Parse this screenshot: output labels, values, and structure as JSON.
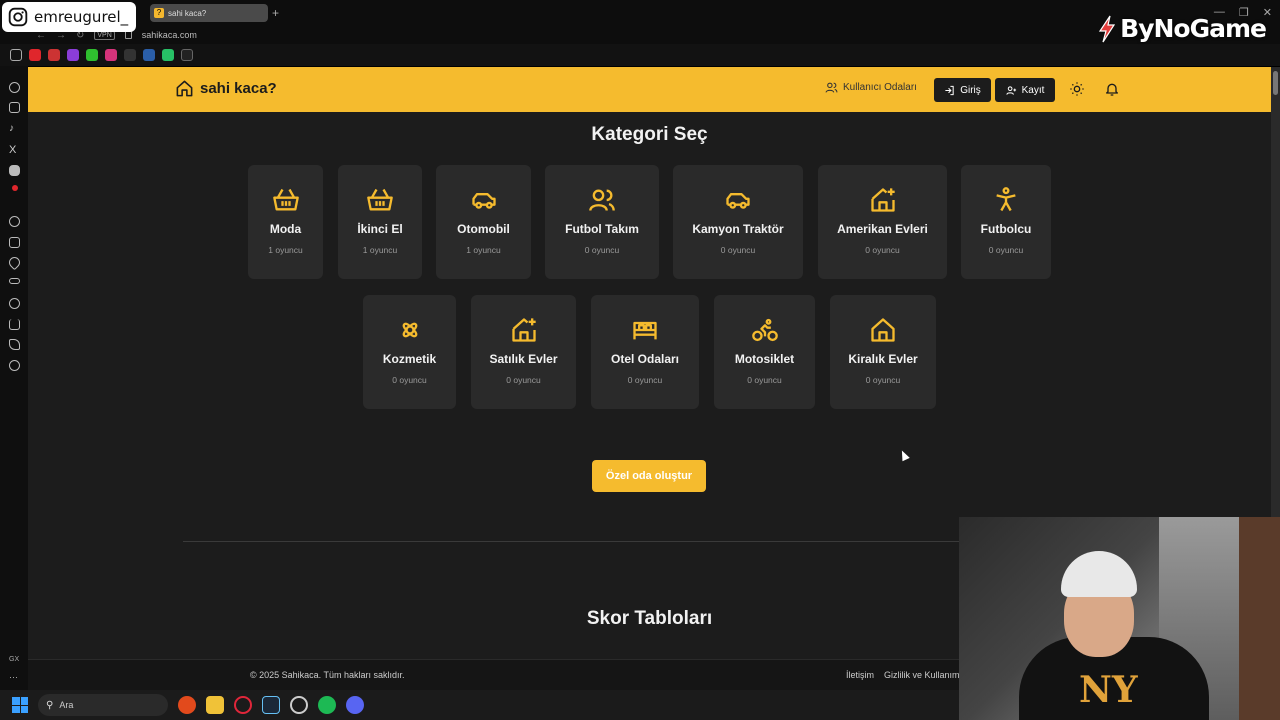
{
  "overlay": {
    "instagram_handle": "emreugurel_",
    "brand_logo": "ByNoGame"
  },
  "browser": {
    "tab_title": "sahi kaca?",
    "new_tab_label": "+",
    "vpn_label": "VPN",
    "url": "sahikaca.com"
  },
  "header": {
    "brand": "sahi kaca?",
    "rooms_link": "Kullanıcı Odaları",
    "login_label": "Giriş",
    "register_label": "Kayıt"
  },
  "main": {
    "title": "Kategori Seç",
    "categories": [
      {
        "name": "Moda",
        "count": "1 oyuncu",
        "icon": "basket-icon"
      },
      {
        "name": "İkinci El",
        "count": "1 oyuncu",
        "icon": "basket-icon"
      },
      {
        "name": "Otomobil",
        "count": "1 oyuncu",
        "icon": "car-icon"
      },
      {
        "name": "Futbol Takım",
        "count": "0 oyuncu",
        "icon": "users-icon"
      },
      {
        "name": "Kamyon Traktör",
        "count": "0 oyuncu",
        "icon": "car-icon"
      },
      {
        "name": "Amerikan Evleri",
        "count": "0 oyuncu",
        "icon": "house-plus-icon"
      },
      {
        "name": "Futbolcu",
        "count": "0 oyuncu",
        "icon": "accessibility-icon"
      },
      {
        "name": "Kozmetik",
        "count": "0 oyuncu",
        "icon": "flower-icon"
      },
      {
        "name": "Satılık Evler",
        "count": "0 oyuncu",
        "icon": "house-plus-icon"
      },
      {
        "name": "Otel Odaları",
        "count": "0 oyuncu",
        "icon": "bed-icon"
      },
      {
        "name": "Motosiklet",
        "count": "0 oyuncu",
        "icon": "bike-icon"
      },
      {
        "name": "Kiralık Evler",
        "count": "0 oyuncu",
        "icon": "house-icon"
      }
    ],
    "create_room_label": "Özel oda oluştur",
    "scoreboard_title": "Skor Tabloları"
  },
  "footer": {
    "copyright": "© 2025 Sahikaca. Tüm hakları saklıdır.",
    "contact": "İletişim",
    "privacy": "Gizlilik ve Kullanım"
  },
  "taskbar": {
    "search_label": "Ara"
  },
  "colors": {
    "accent": "#f5bb2e",
    "card_bg": "#2a2a2a",
    "page_bg": "#1c1c1c"
  }
}
